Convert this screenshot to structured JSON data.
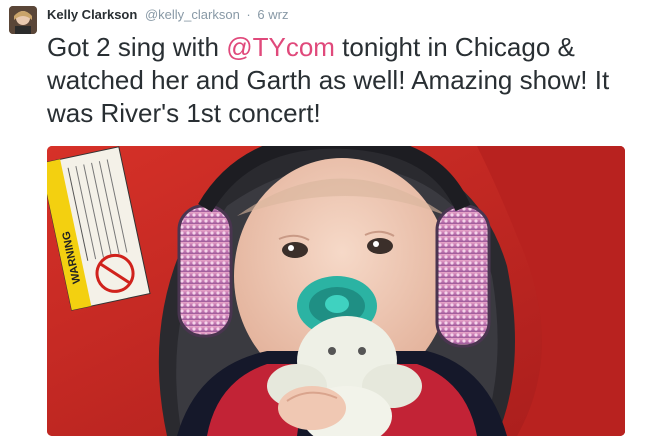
{
  "tweet": {
    "author_name": "Kelly Clarkson",
    "handle": "@kelly_clarkson",
    "separator": "·",
    "timestamp": "6 wrz",
    "text_before": "Got 2 sing with ",
    "mention": "@TYcom",
    "text_after": " tonight in Chicago & watched her and Garth as well! Amazing show! It was River's 1st concert!",
    "mention_color": "#e0497b"
  },
  "media": {
    "warning_label": "WARNING",
    "warning_text": "DO NOT place rear-facing child seat on front seat with air bag. DEATH OR SERIOUS INJURY can occur. The back seat is the safest place for children"
  }
}
